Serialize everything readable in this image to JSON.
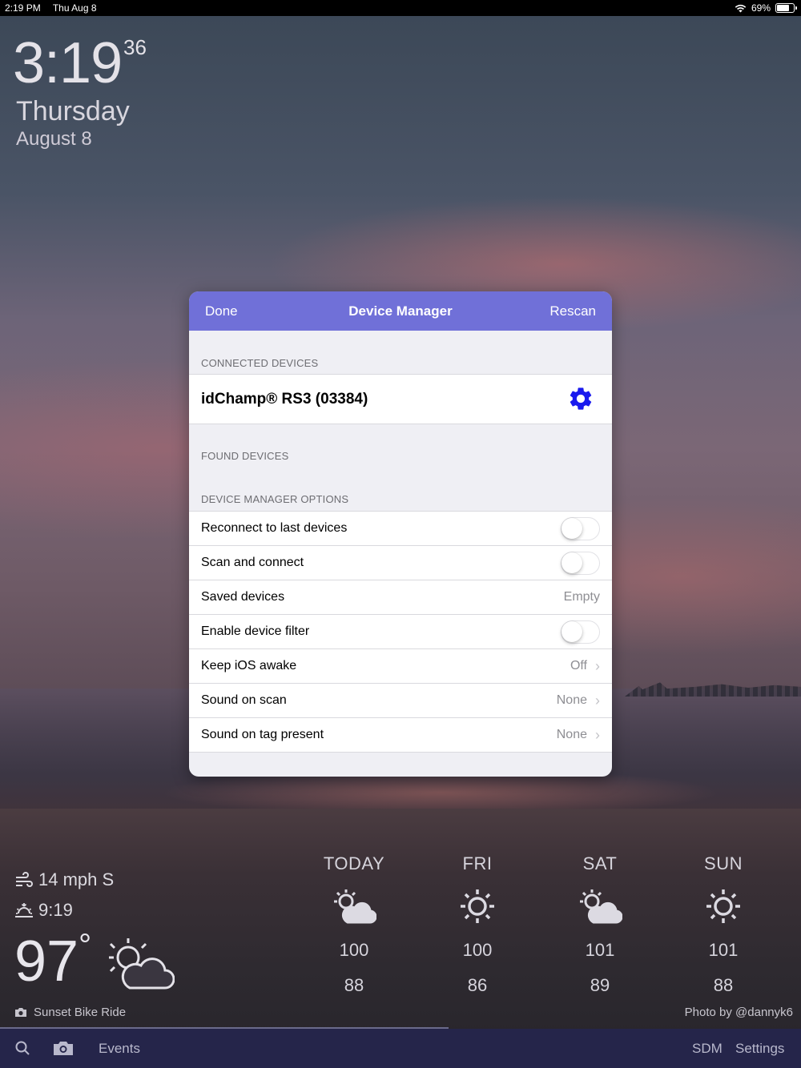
{
  "status_bar": {
    "time": "2:19 PM",
    "date": "Thu Aug 8",
    "battery": "69%",
    "battery_level": 0.69
  },
  "clock": {
    "time": "3:19",
    "seconds": "36",
    "day": "Thursday",
    "date": "August 8"
  },
  "modal": {
    "done_label": "Done",
    "title": "Device Manager",
    "rescan_label": "Rescan",
    "connected_section": "CONNECTED DEVICES",
    "connected_device": "idChamp® RS3 (03384)",
    "found_section": "FOUND DEVICES",
    "options_section": "DEVICE MANAGER OPTIONS",
    "options": [
      {
        "label": "Reconnect to last devices",
        "type": "toggle",
        "on": false
      },
      {
        "label": "Scan and connect",
        "type": "toggle",
        "on": false
      },
      {
        "label": "Saved devices",
        "type": "value",
        "value": "Empty"
      },
      {
        "label": "Enable device filter",
        "type": "toggle",
        "on": false
      },
      {
        "label": "Keep iOS awake",
        "type": "disclosure",
        "value": "Off"
      },
      {
        "label": "Sound on scan",
        "type": "disclosure",
        "value": "None"
      },
      {
        "label": "Sound on tag present",
        "type": "disclosure",
        "value": "None"
      }
    ],
    "accent_color": "#7070d8",
    "gear_color": "#1a1aee"
  },
  "weather": {
    "wind": "14 mph S",
    "sunset": "9:19",
    "temperature": "97",
    "degree": "°",
    "forecast": [
      {
        "day": "TODAY",
        "icon": "partly-cloudy-icon",
        "high": "100",
        "low": "88"
      },
      {
        "day": "FRI",
        "icon": "sun-icon",
        "high": "100",
        "low": "86"
      },
      {
        "day": "SAT",
        "icon": "partly-cloudy-icon",
        "high": "101",
        "low": "89"
      },
      {
        "day": "SUN",
        "icon": "sun-icon",
        "high": "101",
        "low": "88"
      }
    ]
  },
  "photo": {
    "caption": "Sunset Bike Ride",
    "credit": "Photo by @dannyk6"
  },
  "bottom_bar": {
    "events": "Events",
    "sdm": "SDM",
    "settings": "Settings"
  }
}
